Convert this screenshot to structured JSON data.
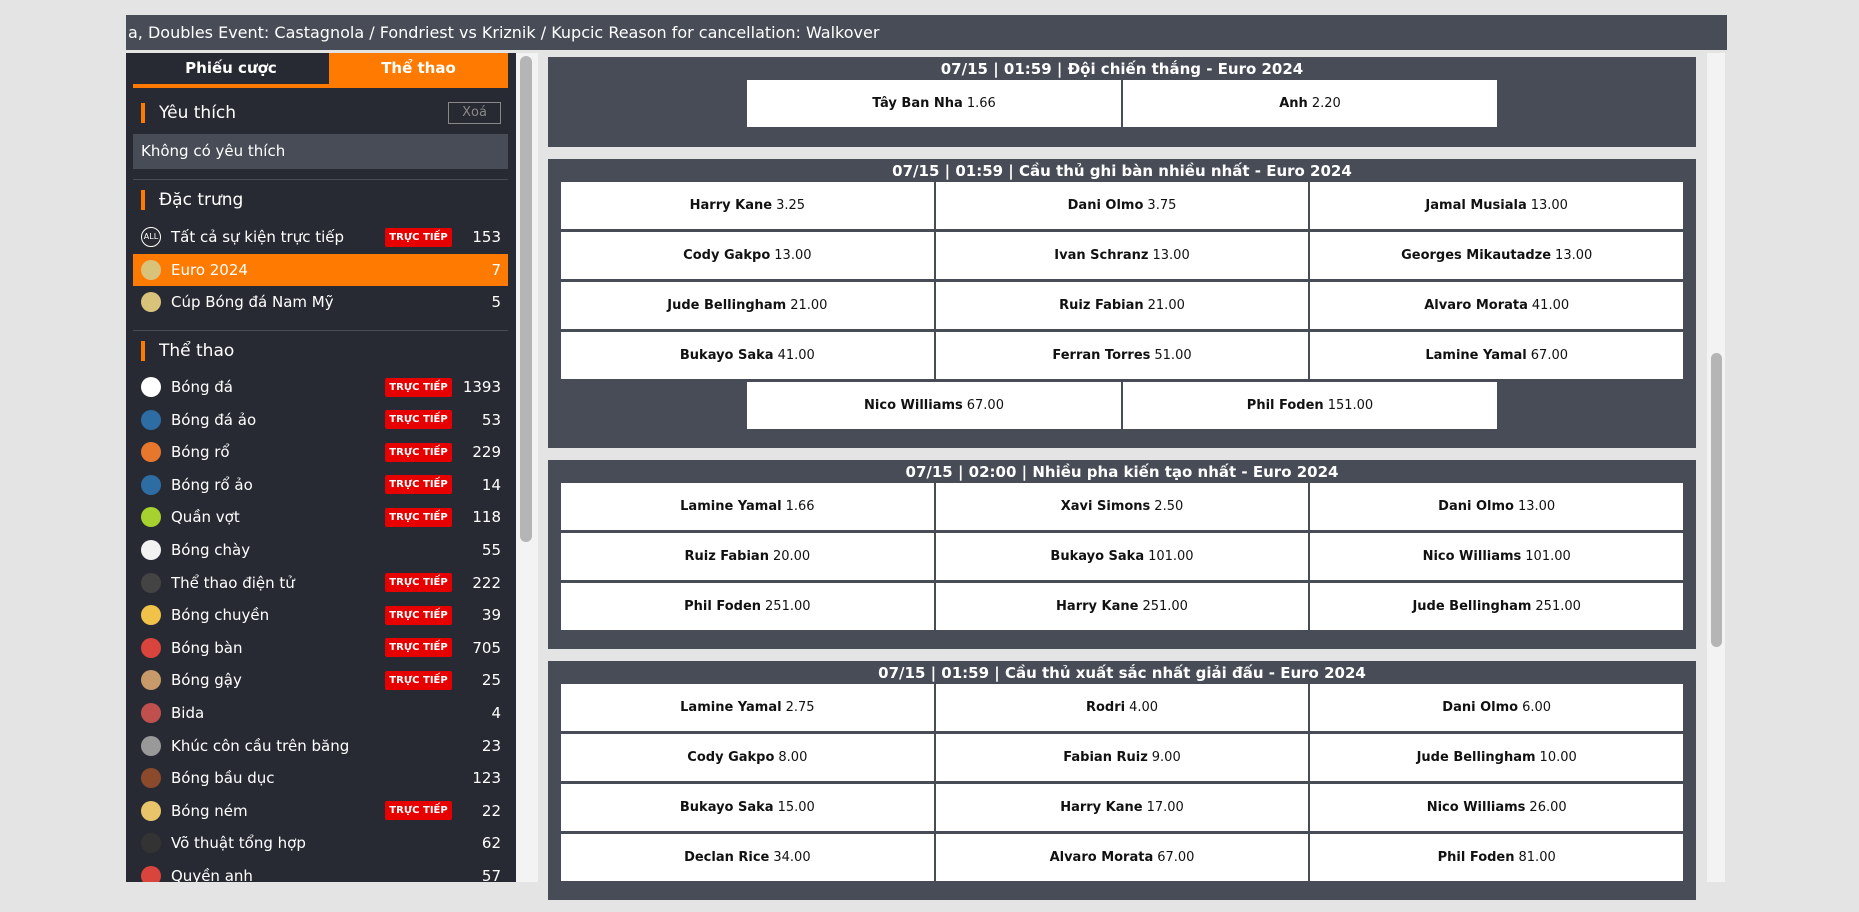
{
  "ticker": "a, Doubles Event: Castagnola / Fondriest vs Kriznik / Kupcic Reason for cancellation: Walkover",
  "tabs": {
    "betslip": "Phiếu cược",
    "sports": "Thể thao"
  },
  "favorites": {
    "title": "Yêu thích",
    "clear": "Xoá",
    "empty": "Không có yêu thích"
  },
  "featured": {
    "title": "Đặc trưng",
    "items": [
      {
        "label": "Tất cả sự kiện trực tiếp",
        "live": true,
        "count": "153",
        "icon": "all-icon",
        "icon_text": "ALL"
      },
      {
        "label": "Euro 2024",
        "live": false,
        "count": "7",
        "icon": "euro-trophy-icon",
        "active": true
      },
      {
        "label": "Cúp Bóng đá Nam Mỹ",
        "live": false,
        "count": "5",
        "icon": "copa-trophy-icon"
      }
    ]
  },
  "live_label": "TRỰC TIẾP",
  "sports": {
    "title": "Thể thao",
    "items": [
      {
        "label": "Bóng đá",
        "live": true,
        "count": "1393",
        "icon": "soccer-ball-icon",
        "color": "#ffffff"
      },
      {
        "label": "Bóng đá ảo",
        "live": true,
        "count": "53",
        "icon": "virtual-soccer-icon",
        "color": "#2e6da4"
      },
      {
        "label": "Bóng rổ",
        "live": true,
        "count": "229",
        "icon": "basketball-icon",
        "color": "#e8772e"
      },
      {
        "label": "Bóng rổ ảo",
        "live": true,
        "count": "14",
        "icon": "virtual-basketball-icon",
        "color": "#2e6da4"
      },
      {
        "label": "Quần vợt",
        "live": true,
        "count": "118",
        "icon": "tennis-ball-icon",
        "color": "#a6d12f"
      },
      {
        "label": "Bóng chày",
        "live": false,
        "count": "55",
        "icon": "baseball-icon",
        "color": "#f2f2f2"
      },
      {
        "label": "Thể thao điện tử",
        "live": true,
        "count": "222",
        "icon": "gamepad-icon",
        "color": "#444"
      },
      {
        "label": "Bóng chuyền",
        "live": true,
        "count": "39",
        "icon": "volleyball-icon",
        "color": "#f0c24a"
      },
      {
        "label": "Bóng bàn",
        "live": true,
        "count": "705",
        "icon": "ping-pong-icon",
        "color": "#d9443c"
      },
      {
        "label": "Bóng gậy",
        "live": true,
        "count": "25",
        "icon": "cricket-icon",
        "color": "#c89a6a"
      },
      {
        "label": "Bida",
        "live": false,
        "count": "4",
        "icon": "billiards-icon",
        "color": "#c0504d"
      },
      {
        "label": "Khúc côn cầu trên băng",
        "live": false,
        "count": "23",
        "icon": "ice-hockey-icon",
        "color": "#999"
      },
      {
        "label": "Bóng bầu dục",
        "live": false,
        "count": "123",
        "icon": "rugby-ball-icon",
        "color": "#8b4a2b"
      },
      {
        "label": "Bóng ném",
        "live": true,
        "count": "22",
        "icon": "handball-icon",
        "color": "#e9c46a"
      },
      {
        "label": "Võ thuật tổng hợp",
        "live": false,
        "count": "62",
        "icon": "mma-glove-icon",
        "color": "#333"
      },
      {
        "label": "Quyền anh",
        "live": false,
        "count": "57",
        "icon": "boxing-glove-icon",
        "color": "#d9443c"
      }
    ]
  },
  "markets": [
    {
      "title": "07/15 | 01:59 | Đội chiến thắng - Euro 2024",
      "rows": [
        [
          [
            "Tây Ban Nha",
            "1.66"
          ],
          [
            "Anh",
            "2.20"
          ]
        ]
      ]
    },
    {
      "title": "07/15 | 01:59 | Cầu thủ ghi bàn nhiều nhất - Euro 2024",
      "rows": [
        [
          [
            "Harry Kane",
            "3.25"
          ],
          [
            "Dani Olmo",
            "3.75"
          ],
          [
            "Jamal Musiala",
            "13.00"
          ]
        ],
        [
          [
            "Cody Gakpo",
            "13.00"
          ],
          [
            "Ivan Schranz",
            "13.00"
          ],
          [
            "Georges Mikautadze",
            "13.00"
          ]
        ],
        [
          [
            "Jude Bellingham",
            "21.00"
          ],
          [
            "Ruiz Fabian",
            "21.00"
          ],
          [
            "Alvaro Morata",
            "41.00"
          ]
        ],
        [
          [
            "Bukayo Saka",
            "41.00"
          ],
          [
            "Ferran Torres",
            "51.00"
          ],
          [
            "Lamine Yamal",
            "67.00"
          ]
        ],
        [
          [
            "Nico Williams",
            "67.00"
          ],
          [
            "Phil Foden",
            "151.00"
          ]
        ]
      ]
    },
    {
      "title": "07/15 | 02:00 | Nhiều pha kiến tạo nhất - Euro 2024",
      "rows": [
        [
          [
            "Lamine Yamal",
            "1.66"
          ],
          [
            "Xavi Simons",
            "2.50"
          ],
          [
            "Dani Olmo",
            "13.00"
          ]
        ],
        [
          [
            "Ruiz Fabian",
            "20.00"
          ],
          [
            "Bukayo Saka",
            "101.00"
          ],
          [
            "Nico Williams",
            "101.00"
          ]
        ],
        [
          [
            "Phil Foden",
            "251.00"
          ],
          [
            "Harry Kane",
            "251.00"
          ],
          [
            "Jude Bellingham",
            "251.00"
          ]
        ]
      ]
    },
    {
      "title": "07/15 | 01:59 | Cầu thủ xuất sắc nhất giải đấu - Euro 2024",
      "rows": [
        [
          [
            "Lamine Yamal",
            "2.75"
          ],
          [
            "Rodri",
            "4.00"
          ],
          [
            "Dani Olmo",
            "6.00"
          ]
        ],
        [
          [
            "Cody Gakpo",
            "8.00"
          ],
          [
            "Fabian Ruiz",
            "9.00"
          ],
          [
            "Jude Bellingham",
            "10.00"
          ]
        ],
        [
          [
            "Bukayo Saka",
            "15.00"
          ],
          [
            "Harry Kane",
            "17.00"
          ],
          [
            "Nico Williams",
            "26.00"
          ]
        ],
        [
          [
            "Declan Rice",
            "34.00"
          ],
          [
            "Alvaro Morata",
            "67.00"
          ],
          [
            "Phil Foden",
            "81.00"
          ]
        ]
      ]
    }
  ],
  "colors": {
    "accent": "#ff7a00",
    "sidebar": "#282a33",
    "panel": "#474c57",
    "live": "#e60000"
  }
}
